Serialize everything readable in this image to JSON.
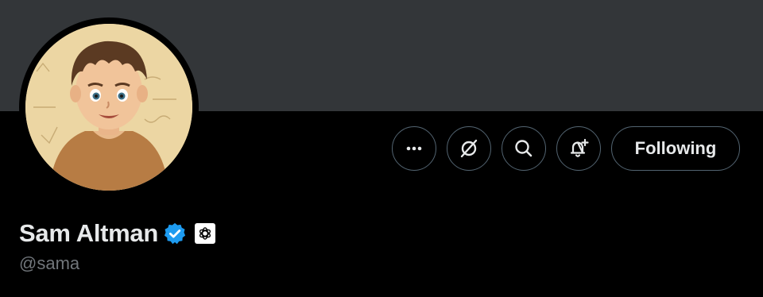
{
  "profile": {
    "display_name": "Sam Altman",
    "handle": "@sama",
    "verified": true,
    "affiliation_badge": "openai-logo-icon"
  },
  "actions": {
    "more_icon": "more-horizontal-icon",
    "grok_icon": "grok-icon",
    "search_icon": "search-icon",
    "notify_icon": "bell-plus-icon",
    "follow_label": "Following"
  },
  "colors": {
    "banner": "#333639",
    "background": "#000000",
    "text_primary": "#e7e9ea",
    "text_secondary": "#71767b",
    "border": "#536471",
    "verified_blue": "#1d9bf0"
  },
  "avatar": {
    "description_icon": "avatar-image"
  }
}
